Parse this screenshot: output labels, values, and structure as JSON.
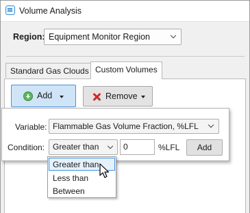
{
  "window": {
    "title": "Volume Analysis",
    "icon": "app-table-icon"
  },
  "region": {
    "label": "Region:",
    "selected": "Equipment Monitor Region"
  },
  "tabs": [
    {
      "label": "Standard Gas Clouds",
      "active": false
    },
    {
      "label": "Custom Volumes",
      "active": true
    }
  ],
  "toolbar": {
    "add_label": "Add",
    "remove_label": "Remove"
  },
  "flyout": {
    "variable_label": "Variable:",
    "variable_value": "Flammable Gas Volume Fraction, %LFL",
    "condition_label": "Condition:",
    "condition_value": "Greater than",
    "threshold_value": "0",
    "unit": "%LFL",
    "add_label": "Add"
  },
  "condition_options": [
    {
      "label": "Greater than",
      "hovered": true
    },
    {
      "label": "Less than",
      "hovered": false
    },
    {
      "label": "Between",
      "hovered": false
    }
  ],
  "colors": {
    "accent": "#4a90d0",
    "add_bg": "#cfe5f7",
    "hover_bg": "#e5f1fb",
    "remove_icon": "#cc2a2a",
    "add_icon": "#5cb85c"
  }
}
